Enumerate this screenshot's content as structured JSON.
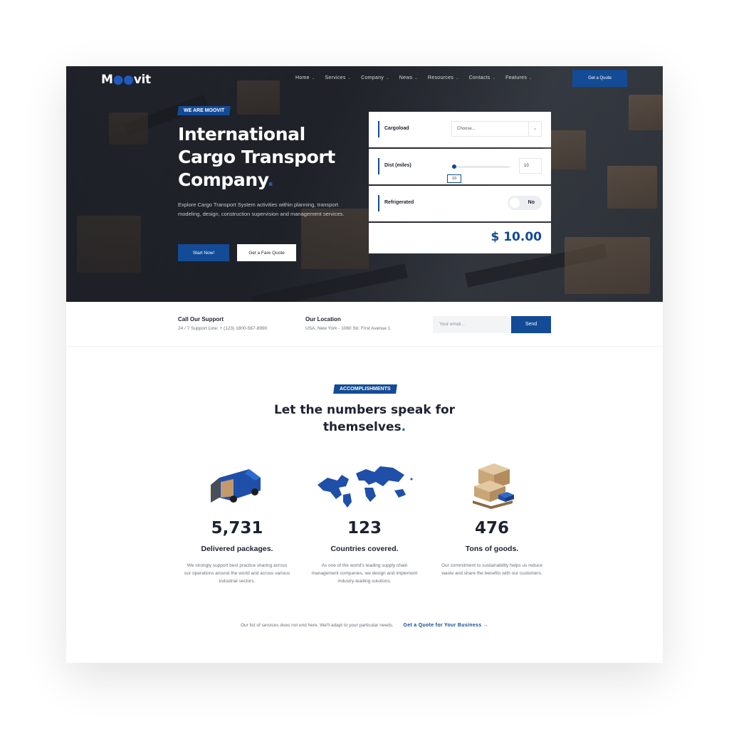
{
  "logo": {
    "pre": "M",
    "dots": "●●",
    "post": "vit"
  },
  "nav": {
    "items": [
      {
        "label": "Home"
      },
      {
        "label": "Services"
      },
      {
        "label": "Company"
      },
      {
        "label": "News"
      },
      {
        "label": "Resources"
      },
      {
        "label": "Contacts"
      },
      {
        "label": "Features"
      }
    ],
    "chevron": "⌄",
    "quote_button": "Get a Quote"
  },
  "hero": {
    "badge": "WE ARE MOOVIT",
    "title": "International Cargo Transport Company",
    "title_dot": ".",
    "description": "Explore Cargo Transport System activities within planning, transport modeling, design, construction supervision and management services.",
    "primary_button": "Start Now!",
    "secondary_button": "Get a Fare Quote"
  },
  "calculator": {
    "cargoload_label": "Cargoload",
    "cargoload_value": "Choose...",
    "distance_label": "Dist (miles)",
    "distance_value": "10",
    "slider_tooltip": "10",
    "slider_level": 0.05,
    "refrigerated_label": "Refrigerated",
    "refrigerated_value": "No",
    "total": "$ 10.00"
  },
  "info": {
    "support_title": "Call Our Support",
    "support_text": "24 / 7 Support Line: + (123) 1800-567-8990",
    "location_title": "Our Location",
    "location_text": "USA, New York - 1060 Str. First Avenue 1",
    "email_placeholder": "Your email...",
    "send_button": "Send"
  },
  "accomplishments": {
    "badge": "ACCOMPLISHMENTS",
    "title_line1": "Let the numbers speak for",
    "title_line2": "themselves",
    "title_dot": ".",
    "stats": [
      {
        "number": "5,731",
        "title": "Delivered packages.",
        "description": "We strongly support best practice sharing across our operations around the world and across various industrial sectors.",
        "icon": "delivery-van-icon"
      },
      {
        "number": "123",
        "title": "Countries covered.",
        "description": "As one of the world's leading supply chain management companies, we design and implement industry-leading solutions.",
        "icon": "world-map-icon"
      },
      {
        "number": "476",
        "title": "Tons of goods.",
        "description": "Our commitment to sustainability helps us reduce waste and share the benefits with our customers.",
        "icon": "boxes-pallet-icon"
      }
    ]
  },
  "footer": {
    "text": "Our list of services does not end here. We'll adapt to your particular needs.",
    "link": "Get a Quote for Your Business →"
  },
  "colors": {
    "accent": "#134b96",
    "dark": "#1c2230"
  }
}
